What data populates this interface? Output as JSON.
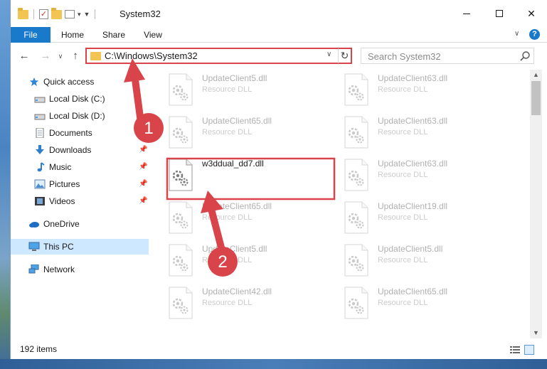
{
  "window": {
    "title": "System32",
    "min_glyph": "—",
    "close_glyph": "✕"
  },
  "ribbon": {
    "tabs": [
      "File",
      "Home",
      "Share",
      "View"
    ],
    "help_glyph": "?"
  },
  "nav": {
    "back_glyph": "←",
    "forward_glyph": "→",
    "recent_glyph": "∨",
    "up_glyph": "↑",
    "address": "C:\\Windows\\System32",
    "search_placeholder": "Search System32"
  },
  "sidebar": {
    "items": [
      {
        "label": "Quick access",
        "icon": "star-icon"
      },
      {
        "label": "Local Disk (C:)",
        "icon": "drive-icon"
      },
      {
        "label": "Local Disk (D:)",
        "icon": "drive-icon"
      },
      {
        "label": "Documents",
        "icon": "documents-icon"
      },
      {
        "label": "Downloads",
        "icon": "downloads-icon"
      },
      {
        "label": "Music",
        "icon": "music-icon"
      },
      {
        "label": "Pictures",
        "icon": "pictures-icon"
      },
      {
        "label": "Videos",
        "icon": "videos-icon"
      },
      {
        "label": "OneDrive",
        "icon": "onedrive-icon"
      },
      {
        "label": "This PC",
        "icon": "this-pc-icon",
        "selected": true
      },
      {
        "label": "Network",
        "icon": "network-icon"
      }
    ]
  },
  "files": [
    {
      "name": "UpdateClient5.dll",
      "type": "Resource DLL"
    },
    {
      "name": "UpdateClient63.dll",
      "type": "Resource DLL"
    },
    {
      "name": "UpdateClient65.dll",
      "type": "Resource DLL"
    },
    {
      "name": "UpdateClient63.dll",
      "type": "Resource DLL"
    },
    {
      "name": "w3ddual_dd7.dll",
      "type": ""
    },
    {
      "name": "UpdateClient63.dll",
      "type": "Resource DLL"
    },
    {
      "name": "UpdateClient65.dll",
      "type": "Resource DLL"
    },
    {
      "name": "UpdateClient19.dll",
      "type": "Resource DLL"
    },
    {
      "name": "UpdateClient5.dll",
      "type": "Resource DLL"
    },
    {
      "name": "UpdateClient5.dll",
      "type": "Resource DLL"
    },
    {
      "name": "UpdateClient42.dll",
      "type": "Resource DLL"
    },
    {
      "name": "UpdateClient65.dll",
      "type": "Resource DLL"
    }
  ],
  "status": {
    "item_count": "192 items"
  },
  "annotations": {
    "step1": "1",
    "step2": "2",
    "accent_color": "#d9434a"
  }
}
